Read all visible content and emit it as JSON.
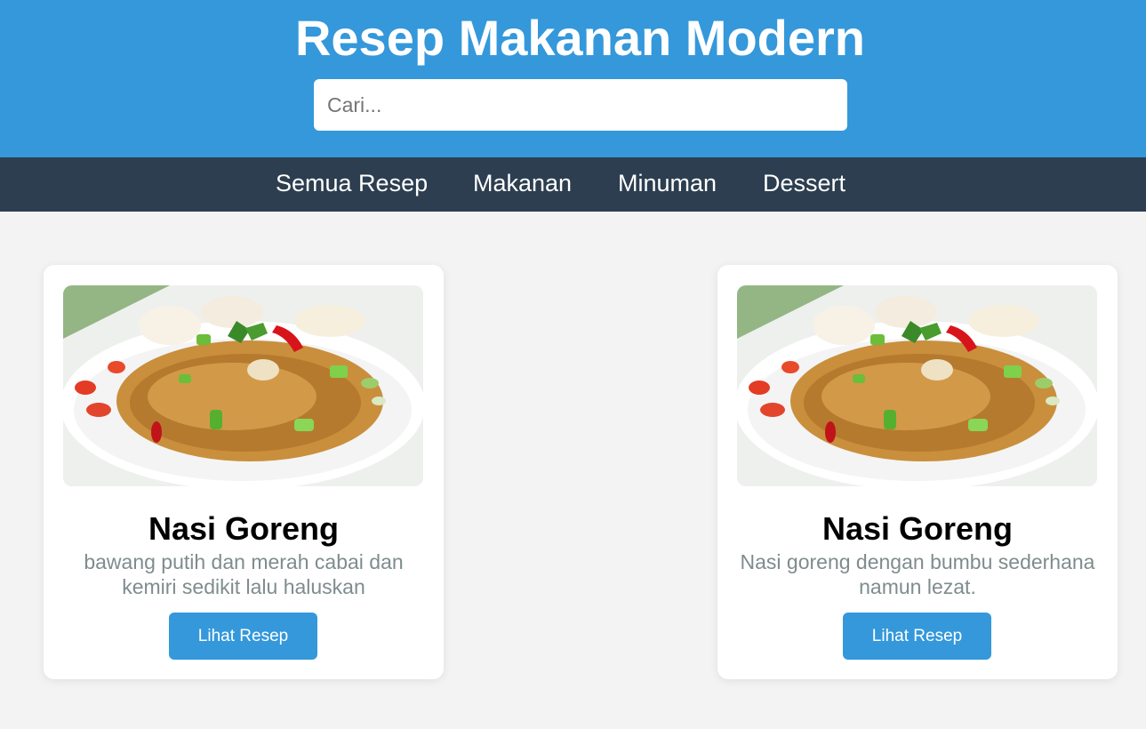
{
  "colors": {
    "header_bg": "#3498db",
    "nav_bg": "#2c3e50",
    "page_bg": "#f3f3f3",
    "button_bg": "#3498db",
    "desc_text": "#7f8c8d"
  },
  "header": {
    "title": "Resep Makanan Modern",
    "search": {
      "placeholder": "Cari...",
      "value": ""
    }
  },
  "nav": {
    "items": [
      {
        "label": "Semua Resep"
      },
      {
        "label": "Makanan"
      },
      {
        "label": "Minuman"
      },
      {
        "label": "Dessert"
      }
    ]
  },
  "recipes": [
    {
      "image_icon": "fried-rice-photo",
      "title": "Nasi Goreng",
      "description": "bawang putih dan merah cabai dan kemiri sedikit lalu haluskan",
      "button_label": "Lihat Resep"
    },
    {
      "image_icon": "fried-rice-photo",
      "title": "Nasi Goreng",
      "description": "Nasi goreng dengan bumbu sederhana namun lezat.",
      "button_label": "Lihat Resep"
    }
  ]
}
